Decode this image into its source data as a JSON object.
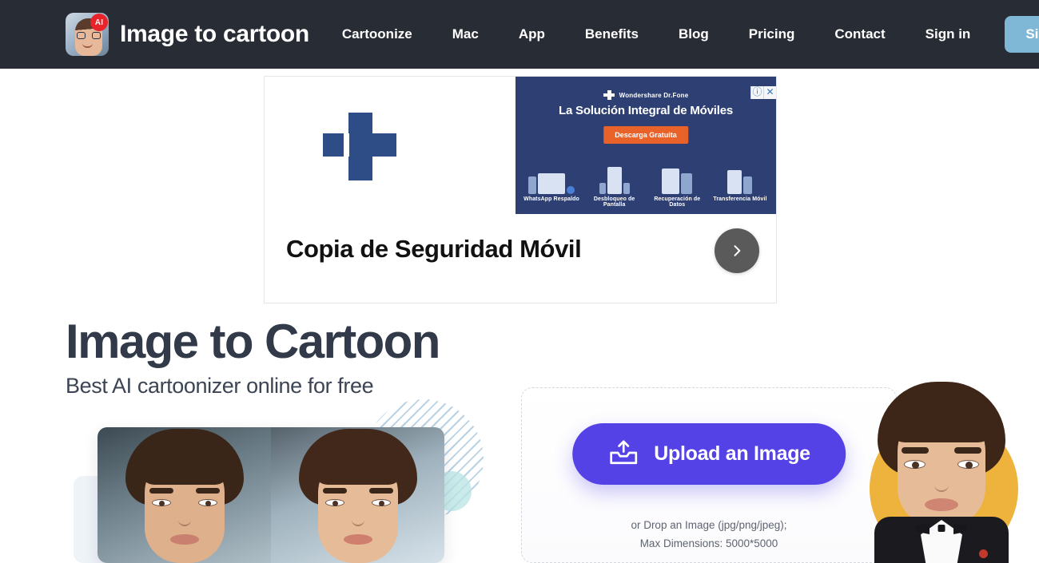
{
  "header": {
    "brand": {
      "name": "Image to cartoon",
      "badge": "AI",
      "logo_icon": "avatar-photo-icon"
    },
    "nav": [
      {
        "label": "Cartoonize"
      },
      {
        "label": "Mac"
      },
      {
        "label": "App"
      },
      {
        "label": "Benefits"
      },
      {
        "label": "Blog"
      },
      {
        "label": "Pricing"
      },
      {
        "label": "Contact"
      },
      {
        "label": "Sign in"
      }
    ],
    "signup_label": "Sign up",
    "background_color": "#282c34",
    "signup_color": "#7fb7d6"
  },
  "ad": {
    "headline": "Copia de Seguridad Móvil",
    "next_icon": "chevron-right-icon",
    "info_icon": "info-icon",
    "close_icon": "close-icon",
    "cross_icon": "wondershare-cross-icon",
    "banner": {
      "brand": "Wondershare Dr.Fone",
      "title": "La Solución Integral de Móviles",
      "cta": "Descarga Gratuita",
      "background_color": "#2e4073",
      "cta_color": "#e8622a",
      "features": [
        {
          "label": "WhatsApp Respaldo"
        },
        {
          "label": "Desbloqueo de Pantalla"
        },
        {
          "label": "Recuperación de Datos"
        },
        {
          "label": "Transferencia Móvil"
        }
      ]
    }
  },
  "hero": {
    "title": "Image to Cartoon",
    "subtitle": "Best AI cartoonizer online for free",
    "title_color": "#323a49"
  },
  "upload": {
    "button_label": "Upload an Image",
    "button_icon": "upload-inbox-icon",
    "button_color": "#5542e6",
    "drop_line1": "or Drop an Image (jpg/png/jpeg);",
    "drop_line2": "Max Dimensions: 5000*5000"
  },
  "showcase": {
    "before_label": "original-photo",
    "after_label": "cartoonized-photo",
    "avatar_circle_color": "#eeb33c"
  }
}
